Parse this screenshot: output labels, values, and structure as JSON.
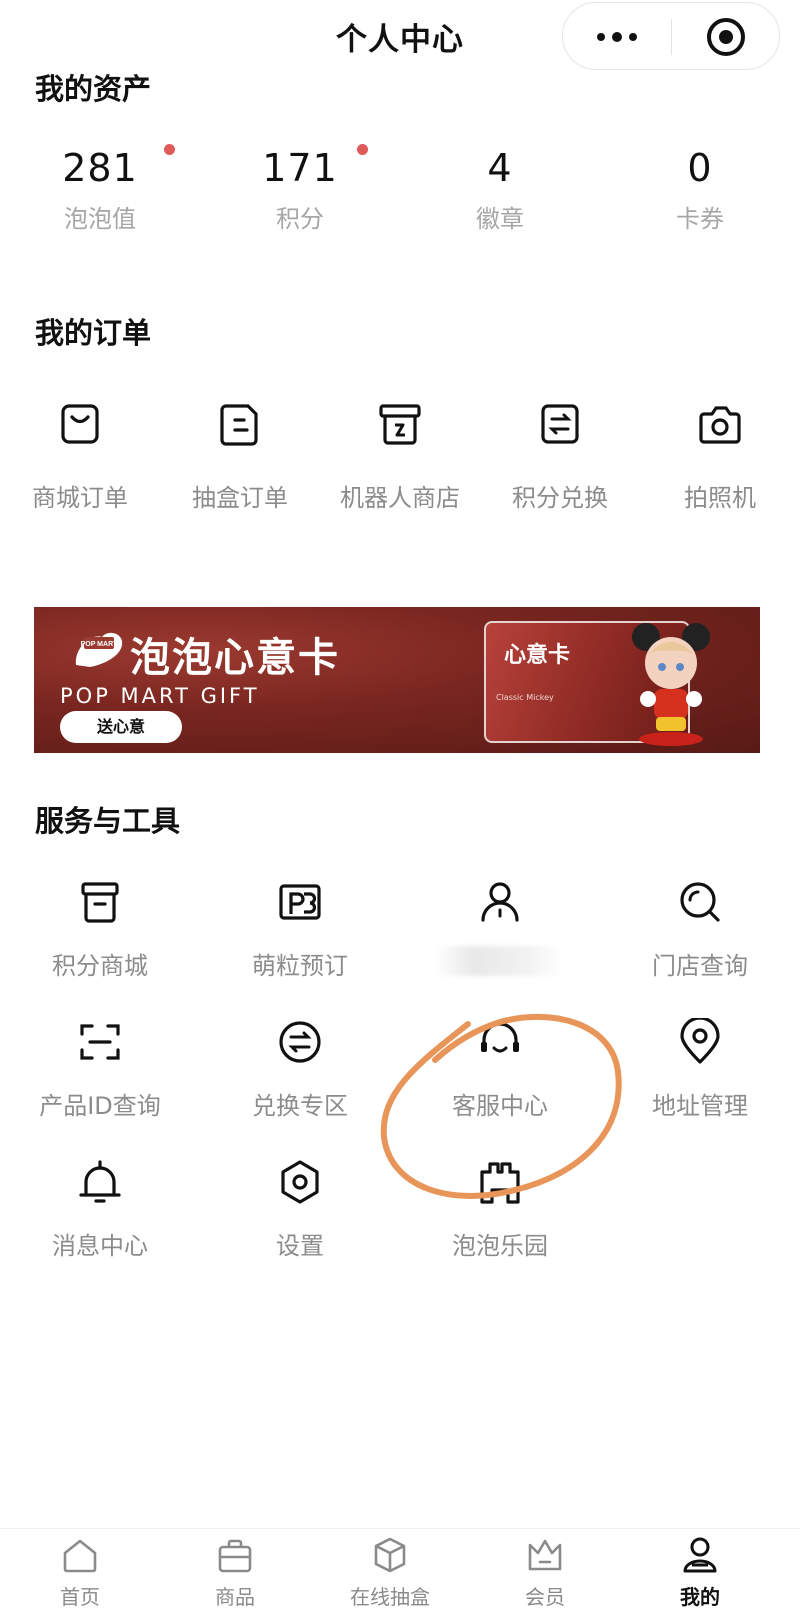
{
  "header": {
    "title": "个人中心",
    "capsule": {
      "more_icon": "more-dots-icon",
      "target_icon": "target-icon"
    }
  },
  "assets": {
    "title": "我的资产",
    "items": [
      {
        "value": "281",
        "label": "泡泡值",
        "badge": true
      },
      {
        "value": "171",
        "label": "积分",
        "badge": true
      },
      {
        "value": "4",
        "label": "徽章",
        "badge": false
      },
      {
        "value": "0",
        "label": "卡券",
        "badge": false
      }
    ]
  },
  "orders": {
    "title": "我的订单",
    "items": [
      {
        "label": "商城订单",
        "icon": "shopping-bag-icon"
      },
      {
        "label": "抽盒订单",
        "icon": "blind-box-order-icon"
      },
      {
        "label": "机器人商店",
        "icon": "robot-store-icon"
      },
      {
        "label": "积分兑换",
        "icon": "points-exchange-icon"
      },
      {
        "label": "拍照机",
        "icon": "camera-icon"
      }
    ]
  },
  "banner": {
    "logo_text": "POP MART",
    "title": "泡泡心意卡",
    "subtitle": "POP MART GIFT",
    "button": "送心意",
    "card_title": "心意卡",
    "card_sub": "Classic Mickey"
  },
  "services": {
    "title": "服务与工具",
    "items": [
      {
        "label": "积分商城",
        "icon": "points-mall-icon"
      },
      {
        "label": "萌粒预订",
        "icon": "mengli-reserve-icon"
      },
      {
        "label": "",
        "icon": "user-icon",
        "blurred": true
      },
      {
        "label": "门店查询",
        "icon": "store-search-icon"
      },
      {
        "label": "产品ID查询",
        "icon": "scan-icon"
      },
      {
        "label": "兑换专区",
        "icon": "exchange-icon"
      },
      {
        "label": "客服中心",
        "icon": "headset-icon"
      },
      {
        "label": "地址管理",
        "icon": "location-icon"
      },
      {
        "label": "消息中心",
        "icon": "bell-icon"
      },
      {
        "label": "设置",
        "icon": "settings-icon"
      },
      {
        "label": "泡泡乐园",
        "icon": "park-icon"
      }
    ]
  },
  "annotation": {
    "color": "#e8955a"
  },
  "tabbar": {
    "items": [
      {
        "label": "首页",
        "icon": "home-icon",
        "active": false
      },
      {
        "label": "商品",
        "icon": "shopping-bag-icon",
        "active": false
      },
      {
        "label": "在线抽盒",
        "icon": "cube-icon",
        "active": false
      },
      {
        "label": "会员",
        "icon": "crown-icon",
        "active": false
      },
      {
        "label": "我的",
        "icon": "profile-icon",
        "active": true
      }
    ]
  },
  "colors": {
    "badge_dot": "#e05a5a",
    "label_grey": "#8c8c8c",
    "banner_red": "#7a2620"
  }
}
